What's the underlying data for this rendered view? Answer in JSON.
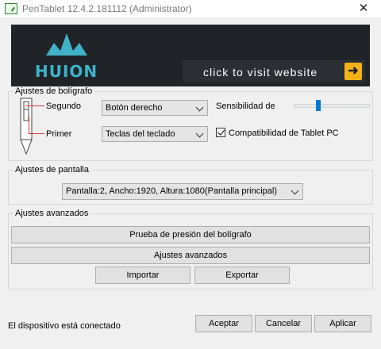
{
  "window": {
    "title": "PenTablet 12.4.2.181112 (Administrator)",
    "close_glyph": "✕"
  },
  "banner": {
    "logo_text": "HUION",
    "visit_text": "click to visit website",
    "arrow_glyph": "➜",
    "colors": {
      "background": "#202327",
      "logo": "#3fb2c9",
      "arrow": "#f3b218"
    }
  },
  "pen": {
    "group_label": "Ajustes de bolígrafo",
    "upper_label": "Segundo",
    "lower_label": "Primer",
    "upper_value": "Botón derecho",
    "lower_value": "Teclas del teclado",
    "sensitivity_label": "Sensibilidad de",
    "sensitivity_level": 0.35,
    "tablet_pc_label": "Compatibilidad de Tablet PC",
    "tablet_pc_checked": true
  },
  "screen": {
    "group_label": "Ajustes de pantalla",
    "display_value": "Pantalla:2, Ancho:1920, Altura:1080(Pantalla principal)"
  },
  "advanced": {
    "group_label": "Ajustes avanzados",
    "pressure_test_label": "Prueba de presión del bolígrafo",
    "advanced_label": "Ajustes avanzados",
    "import_label": "Importar",
    "export_label": "Exportar"
  },
  "footer": {
    "status": "El dispositivo está conectado",
    "accept_label": "Aceptar",
    "cancel_label": "Cancelar",
    "apply_label": "Aplicar"
  },
  "icons": [
    "app-icon",
    "huion-crown-icon",
    "arrow-right-icon",
    "chevron-down-icon",
    "pen-icon",
    "checkmark-icon",
    "close-icon"
  ]
}
